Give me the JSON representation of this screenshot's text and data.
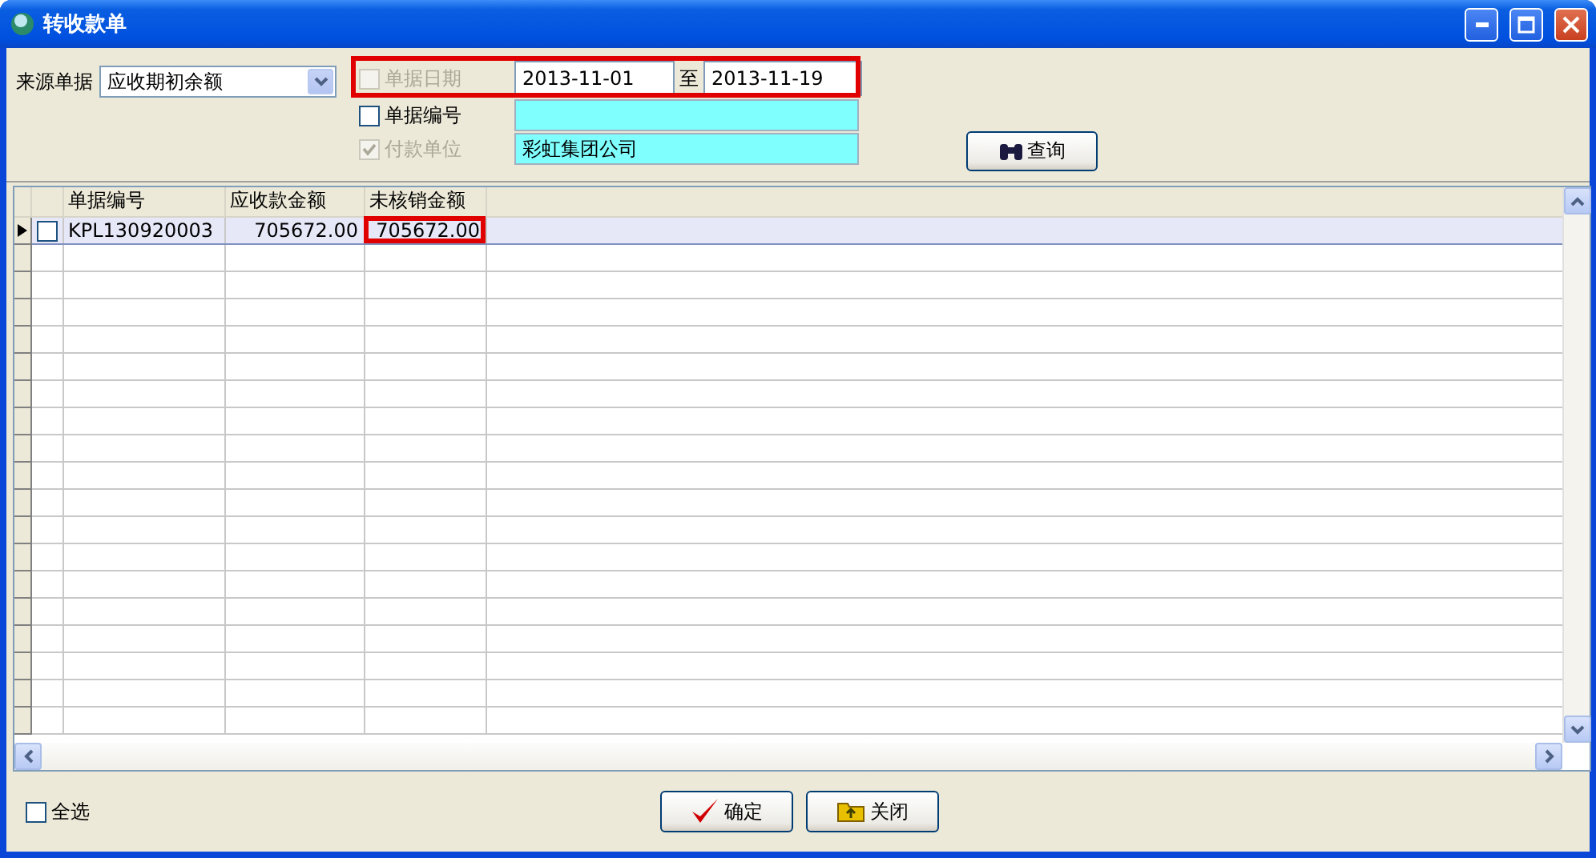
{
  "window": {
    "title": "转收款单"
  },
  "source": {
    "label": "来源单据",
    "value": "应收期初余额"
  },
  "date_filter": {
    "label": "单据日期",
    "checked": false,
    "disabled": true,
    "highlighted": true,
    "from": "2013-11-01",
    "separator": "至",
    "to": "2013-11-19"
  },
  "number_filter": {
    "label": "单据编号",
    "checked": false,
    "disabled": false
  },
  "payer_filter": {
    "label": "付款单位",
    "checked": true,
    "disabled": true,
    "value": "彩虹集团公司"
  },
  "query_button": "查询",
  "table": {
    "columns": [
      "单据编号",
      "应收款金额",
      "未核销金额"
    ],
    "rows": [
      {
        "selected": true,
        "checked": false,
        "cells": [
          {
            "text": "KPL130920003",
            "highlighted": false
          },
          {
            "text": "705672.00",
            "highlighted": false
          },
          {
            "text": "705672.00",
            "highlighted": true
          }
        ]
      }
    ]
  },
  "select_all": {
    "label": "全选",
    "checked": false
  },
  "buttons": [
    {
      "kind": "ok",
      "label": "确定"
    },
    {
      "kind": "close",
      "label": "关闭"
    }
  ]
}
